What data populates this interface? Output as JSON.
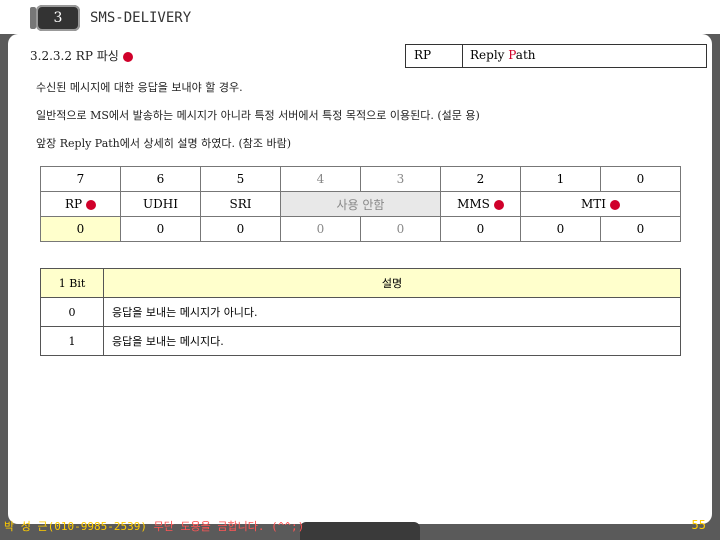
{
  "header": {
    "chapter": "3",
    "title": "SMS-DELIVERY"
  },
  "section": {
    "title": "3.2.3.2 RP 파싱"
  },
  "rp_box": {
    "key": "RP",
    "value_prefix": "Reply ",
    "value_highlight": "P",
    "value_suffix": "ath"
  },
  "lines": [
    "수신된 메시지에 대한 응답을 보내야 할 경우.",
    "일반적으로 MS에서 발송하는 메시지가 아니라 특정 서버에서 특정 목적으로 이용된다. (설문 용)",
    "앞장 Reply Path에서 상세히 설명 하였다. (참조 바람)"
  ],
  "bit_table": {
    "bits": [
      "7",
      "6",
      "5",
      "4",
      "3",
      "2",
      "1",
      "0"
    ],
    "fields": {
      "rp": "RP",
      "udhi": "UDHI",
      "sri": "SRI",
      "unused": "사용 안함",
      "mms": "MMS",
      "mti": "MTI"
    },
    "values": [
      "0",
      "0",
      "0",
      "0",
      "0",
      "0",
      "0",
      "0"
    ]
  },
  "desc_table": {
    "header": {
      "bit": "1 Bit",
      "desc": "설명"
    },
    "rows": [
      {
        "bit": "0",
        "desc": "응답을 보내는 메시지가 아니다."
      },
      {
        "bit": "1",
        "desc": "응답을 보내는 메시지다."
      }
    ]
  },
  "footer": {
    "author": "박 성 근(010-9985-2539)",
    "warning": " 무단 도용을 금합니다. (^^;)",
    "page": "55"
  },
  "colors": {
    "accent": "#d0002a",
    "footer": "#ffcc00"
  }
}
